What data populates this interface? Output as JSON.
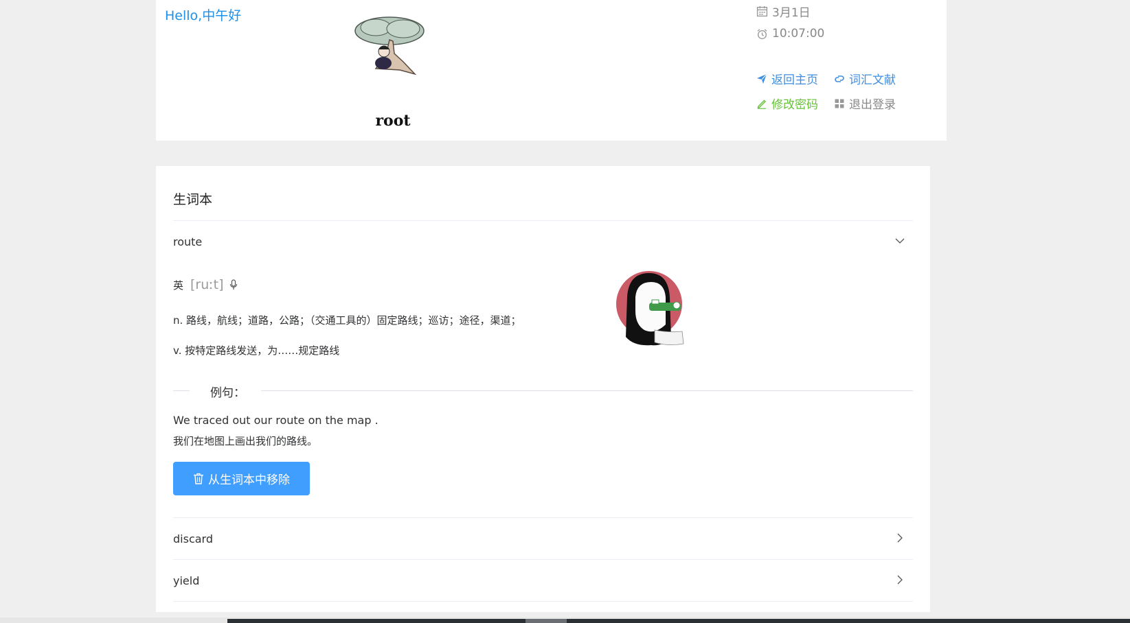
{
  "header": {
    "greeting": "Hello,中午好",
    "username": "root",
    "date": "3月1日",
    "time": "10:07:00",
    "links": {
      "home": "返回主页",
      "literature": "词汇文献",
      "change_password": "修改密码",
      "logout": "退出登录"
    }
  },
  "vocab": {
    "title": "生词本",
    "words": [
      {
        "word": "route",
        "expanded": true,
        "accent_label": "英",
        "phonetic": "[ruːt]",
        "definitions": [
          "n. 路线，航线；道路，公路；（交通工具的）固定路线；巡访；途径，渠道；",
          "v. 按特定路线发送，为……规定路线"
        ],
        "example_label": "例句：",
        "example_en": "We traced out our route on the map .",
        "example_zh": "我们在地图上画出我们的路线。",
        "remove_label": "从生词本中移除"
      },
      {
        "word": "discard",
        "expanded": false
      },
      {
        "word": "yield",
        "expanded": false
      }
    ]
  },
  "colors": {
    "primary": "#409eff",
    "link_blue": "#3d8ee0",
    "success": "#67c23a",
    "greeting": "#1e90e8"
  }
}
